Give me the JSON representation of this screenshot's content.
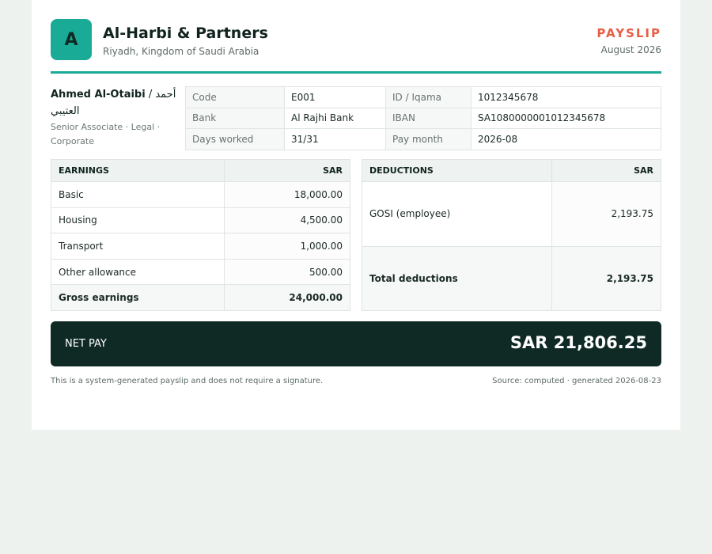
{
  "company": {
    "logo_letter": "A",
    "name": "Al-Harbi & Partners",
    "address": "Riyadh, Kingdom of Saudi Arabia"
  },
  "document": {
    "title": "PAYSLIP",
    "period": "August 2026"
  },
  "employee": {
    "name_en": "Ahmed Al-Otaibi",
    "separator": " / ",
    "name_ar": "أحمد العتيبي",
    "role": "Senior Associate · Legal · Corporate"
  },
  "details": [
    {
      "label": "Code",
      "value": "E001",
      "label2": "ID / Iqama",
      "value2": "1012345678"
    },
    {
      "label": "Bank",
      "value": "Al Rajhi Bank",
      "label2": "IBAN",
      "value2": "SA1080000001012345678"
    },
    {
      "label": "Days worked",
      "value": "31/31",
      "label2": "Pay month",
      "value2": "2026-08"
    }
  ],
  "earnings": {
    "header": "EARNINGS",
    "currency": "SAR",
    "rows": [
      {
        "label": "Basic",
        "amount": "18,000.00"
      },
      {
        "label": "Housing",
        "amount": "4,500.00"
      },
      {
        "label": "Transport",
        "amount": "1,000.00"
      },
      {
        "label": "Other allowance",
        "amount": "500.00"
      }
    ],
    "total_label": "Gross earnings",
    "total_amount": "24,000.00"
  },
  "deductions": {
    "header": "DEDUCTIONS",
    "currency": "SAR",
    "rows": [
      {
        "label": "GOSI (employee)",
        "amount": "2,193.75"
      }
    ],
    "total_label": "Total deductions",
    "total_amount": "2,193.75"
  },
  "net_pay": {
    "label": "NET PAY",
    "value": "SAR 21,806.25"
  },
  "footer": {
    "note": "This is a system-generated payslip and does not require a signature.",
    "source": "Source: computed · generated 2026-08-23"
  },
  "colors": {
    "accent": "#1aab96",
    "title": "#e85d44",
    "dark": "#0f2a25"
  }
}
